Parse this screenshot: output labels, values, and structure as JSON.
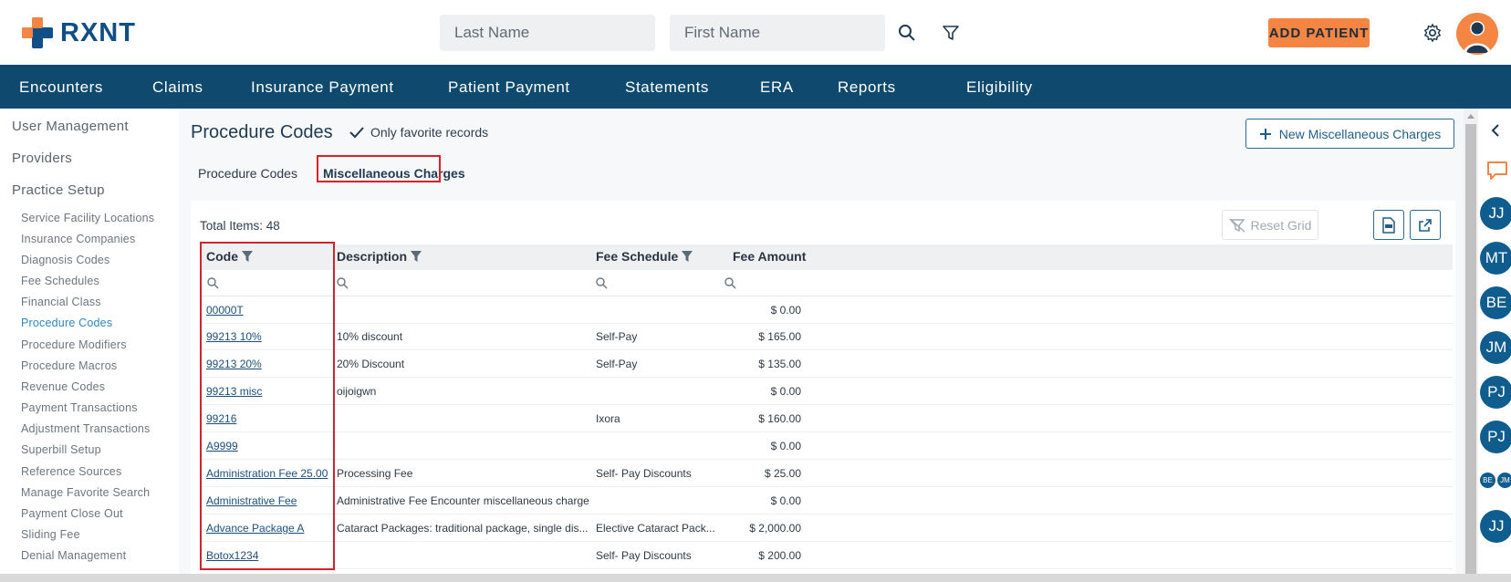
{
  "header": {
    "logo_text": "RXNT",
    "last_name_placeholder": "Last Name",
    "first_name_placeholder": "First Name",
    "add_patient_label": "ADD PATIENT"
  },
  "nav": {
    "items": [
      "Encounters",
      "Claims",
      "Insurance Payment",
      "Patient Payment",
      "Statements",
      "ERA",
      "Reports",
      "Eligibility"
    ]
  },
  "sidebar": {
    "headings": [
      "User Management",
      "Providers",
      "Practice Setup"
    ],
    "items": [
      "Service Facility Locations",
      "Insurance Companies",
      "Diagnosis Codes",
      "Fee Schedules",
      "Financial Class",
      "Procedure Codes",
      "Procedure Modifiers",
      "Procedure Macros",
      "Revenue Codes",
      "Payment Transactions",
      "Adjustment Transactions",
      "Superbill Setup",
      "Reference Sources",
      "Manage Favorite Search",
      "Payment Close Out",
      "Sliding Fee",
      "Denial Management"
    ],
    "active_index": 5
  },
  "main": {
    "title": "Procedure Codes",
    "favorite_label": "Only favorite records",
    "new_button_label": "New Miscellaneous Charges",
    "tabs": [
      "Procedure Codes",
      "Miscellaneous Charges"
    ],
    "selected_tab": 1,
    "total_items_label": "Total Items: 48",
    "reset_grid_label": "Reset Grid",
    "columns": [
      "Code",
      "Description",
      "Fee Schedule",
      "Fee Amount"
    ],
    "rows": [
      {
        "code": "00000T",
        "description": "",
        "fee_schedule": "",
        "fee_amount": "$ 0.00"
      },
      {
        "code": "99213 10%",
        "description": "10% discount",
        "fee_schedule": "Self-Pay",
        "fee_amount": "$ 165.00"
      },
      {
        "code": "99213 20%",
        "description": "20% Discount",
        "fee_schedule": "Self-Pay",
        "fee_amount": "$ 135.00"
      },
      {
        "code": "99213 misc",
        "description": "oijoigwn",
        "fee_schedule": "",
        "fee_amount": "$ 0.00"
      },
      {
        "code": "99216",
        "description": "",
        "fee_schedule": "Ixora",
        "fee_amount": "$ 160.00"
      },
      {
        "code": "A9999",
        "description": "",
        "fee_schedule": "",
        "fee_amount": "$ 0.00"
      },
      {
        "code": "Administration Fee 25.00",
        "description": "Processing Fee",
        "fee_schedule": "Self- Pay Discounts",
        "fee_amount": "$ 25.00"
      },
      {
        "code": "Administrative Fee",
        "description": "Administrative Fee Encounter miscellaneous charge",
        "fee_schedule": "",
        "fee_amount": "$ 0.00"
      },
      {
        "code": "Advance Package A",
        "description": "Cataract Packages: traditional package, single dis...",
        "fee_schedule": "Elective Cataract Pack...",
        "fee_amount": "$ 2,000.00"
      },
      {
        "code": "Botox1234",
        "description": "",
        "fee_schedule": "Self- Pay Discounts",
        "fee_amount": "$ 200.00"
      }
    ]
  },
  "rail": {
    "avatars": [
      "JJ",
      "MT",
      "BE",
      "JM",
      "PJ",
      "PJ",
      "BE",
      "JM",
      "JJ"
    ]
  },
  "colors": {
    "brand_blue": "#0f4a6e",
    "accent_orange": "#f58542",
    "highlight_red": "#d6212a"
  }
}
